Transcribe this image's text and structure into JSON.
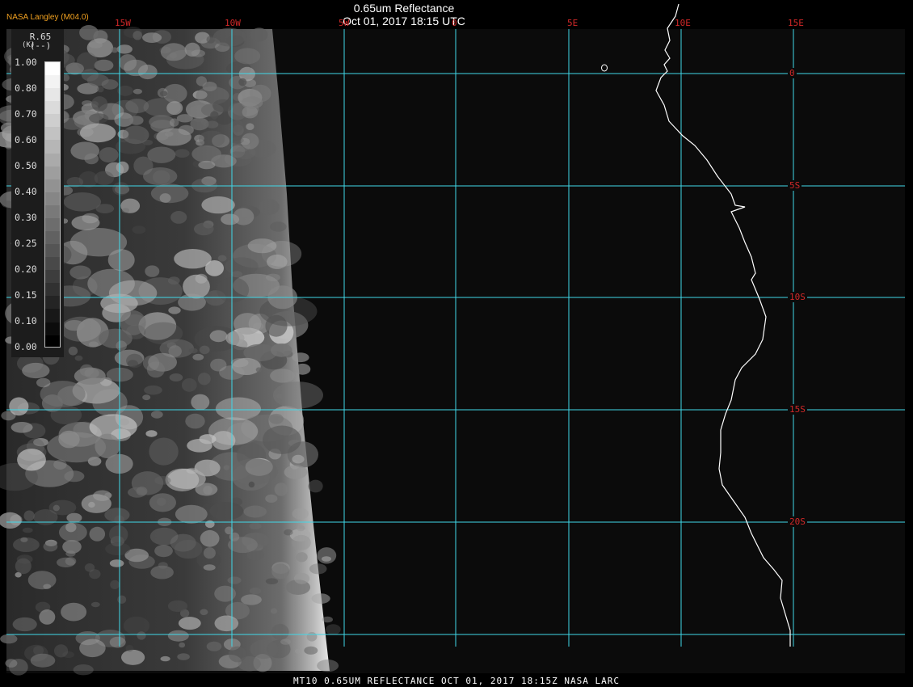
{
  "header": {
    "credit": "NASA Langley (M04.0)",
    "title_line1": "0.65um Reflectance",
    "title_line2": "Oct 01, 2017 18:15 UTC"
  },
  "footer": {
    "caption": "MT10  0.65UM REFLECTANCE   OCT 01, 2017 18:15Z   NASA LARC"
  },
  "legend": {
    "name": "R.65",
    "unit": "(--)",
    "unit_prefix": "(K)",
    "ticks": [
      "1.00",
      "0.80",
      "0.70",
      "0.60",
      "0.50",
      "0.40",
      "0.30",
      "0.25",
      "0.20",
      "0.15",
      "0.10",
      "0.00"
    ]
  },
  "grid": {
    "lon_labels": [
      "15W",
      "10W",
      "5W",
      "0",
      "5E",
      "10E",
      "15E"
    ],
    "lat_labels": [
      "0",
      "5S",
      "10S",
      "15S",
      "20S"
    ]
  },
  "colors": {
    "background": "#000000",
    "map_dark": "#0b0b0b",
    "gridline": "#40d8e8",
    "grid_label": "#d02828",
    "coastline": "#ffffff",
    "credit": "#f0a020"
  }
}
